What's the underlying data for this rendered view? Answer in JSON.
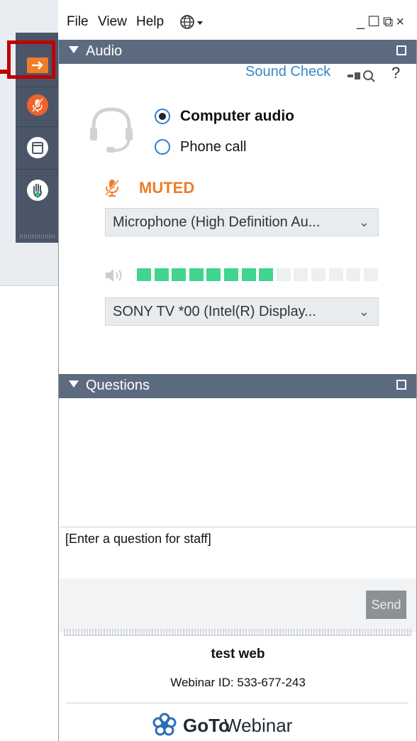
{
  "menubar": {
    "file_label": "File",
    "view_label": "View",
    "help_label": "Help",
    "globe_icon": "globe-icon",
    "window_controls": "_☐⧉×"
  },
  "toolbar": {
    "items": [
      {
        "name": "collapse-arrow",
        "icon": "arrow-right-icon"
      },
      {
        "name": "mute-microphone",
        "icon": "microphone-muted-icon"
      },
      {
        "name": "screen",
        "icon": "window-icon"
      },
      {
        "name": "raise-hand",
        "icon": "hand-icon"
      }
    ]
  },
  "audio": {
    "header_label": "Audio",
    "sound_check_label": "Sound Check",
    "help_label": "?",
    "computer_audio_label": "Computer audio",
    "phone_call_label": "Phone call",
    "selected_mode": "Computer audio",
    "muted_label": "MUTED",
    "microphone_device": "Microphone (High Definition Au...",
    "speaker_device": "SONY TV  *00 (Intel(R) Display...",
    "speaker_level_fraction": 0.57,
    "colors": {
      "muted": "#f07c2a",
      "meter_on": "#3fd58f",
      "meter_off": "#edf0f2",
      "header": "#5d6b80"
    }
  },
  "questions": {
    "header_label": "Questions",
    "input_placeholder": "[Enter a question for staff]",
    "send_label": "Send"
  },
  "footer": {
    "webinar_title": "test web",
    "webinar_id": "Webinar ID: 533-677-243",
    "logo_text_bold": "GoTo",
    "logo_text_light": "Webinar"
  }
}
